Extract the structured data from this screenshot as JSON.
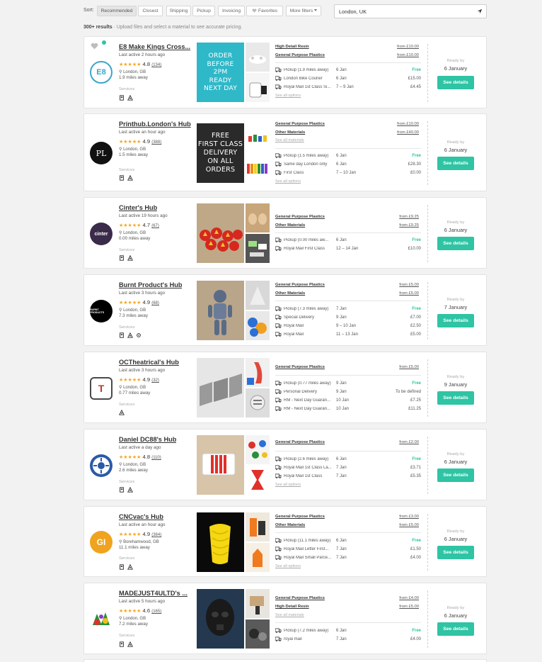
{
  "sort": {
    "label": "Sort:",
    "options": [
      "Recommended",
      "Closest",
      "Shipping",
      "Pickup",
      "Invoicing",
      "Favorites",
      "More filters"
    ],
    "active": "Recommended"
  },
  "location": {
    "value": "London, UK"
  },
  "results": {
    "count": "300+ results",
    "hint": " · Upload files and select a material to see accurate pricing."
  },
  "colors": {
    "accent": "#2ec4a4",
    "star": "#f5a623"
  },
  "hubs": [
    {
      "name": "E8 Make Kings Cross...",
      "active": "Last active 2 hours ago",
      "rating": "4.8",
      "reviews": "(134)",
      "location": "London, GB",
      "distance": "1.9 miles away",
      "services_label": "Services",
      "logo_text": "E8",
      "promo": [
        "ORDER",
        "BEFORE",
        "2PM",
        "READY",
        "NEXT DAY"
      ],
      "materials": [
        {
          "name": "High Detail Resin",
          "price": "from £10.00"
        },
        {
          "name": "General Purpose Plastics",
          "price": "from £10.00"
        }
      ],
      "shipping": [
        {
          "method": "Pickup (1.9 miles away)",
          "date": "6 Jan",
          "price": "Free"
        },
        {
          "method": "London Bike Courier",
          "date": "6 Jan",
          "price": "£15.00"
        },
        {
          "method": "Royal Mail 1st Class Si...",
          "date": "7 – 9 Jan",
          "price": "£4.45"
        }
      ],
      "see_all": "See all options",
      "ready_label": "Ready by",
      "ready_date": "6 January",
      "button": "See details"
    },
    {
      "name": "Printhub.London's Hub",
      "active": "Last active an hour ago",
      "rating": "4.9",
      "reviews": "(388)",
      "location": "London, GB",
      "distance": "1.5 miles away",
      "services_label": "Services",
      "logo_text": "PL",
      "promo": [
        "FREE",
        "FIRST CLASS",
        "DELIVERY",
        "ON ALL",
        "ORDERS"
      ],
      "materials": [
        {
          "name": "General Purpose Plastics",
          "price": "from £10.00"
        },
        {
          "name": "Other Materials",
          "price": "from £40.00"
        }
      ],
      "see_materials": "See all materials",
      "shipping": [
        {
          "method": "Pickup (1.5 miles away)",
          "date": "6 Jan",
          "price": "Free"
        },
        {
          "method": "Same day London only",
          "date": "6 Jan",
          "price": "£28.30"
        },
        {
          "method": "First Class",
          "date": "7 – 10 Jan",
          "price": "£0.00"
        }
      ],
      "see_all": "See all options",
      "ready_label": "Ready by",
      "ready_date": "6 January",
      "button": "See details"
    },
    {
      "name": "Cinter's Hub",
      "active": "Last active 19 hours ago",
      "rating": "4.7",
      "reviews": "(67)",
      "location": "London, GB",
      "distance": "0.00 miles away",
      "services_label": "Services",
      "logo_text": "cinter",
      "materials": [
        {
          "name": "General Purpose Plastics",
          "price": "from £9.25"
        },
        {
          "name": "Other Materials",
          "price": "from £9.25"
        }
      ],
      "shipping": [
        {
          "method": "Pickup (0.00 miles aw...",
          "date": "6 Jan",
          "price": "Free"
        },
        {
          "method": "Royal Mail First Class",
          "date": "12 – 14 Jan",
          "price": "£10.00"
        }
      ],
      "ready_label": "Ready by",
      "ready_date": "6 January",
      "button": "See details"
    },
    {
      "name": "Burnt Product's Hub",
      "active": "Last active 3 hours ago",
      "rating": "4.9",
      "reviews": "(68)",
      "location": "London, GB",
      "distance": "7.3 miles away",
      "services_label": "Services",
      "logo_text": "BURNT PRODUCTS",
      "materials": [
        {
          "name": "General Purpose Plastics",
          "price": "from £5.00"
        },
        {
          "name": "Other Materials",
          "price": "from £5.00"
        }
      ],
      "shipping": [
        {
          "method": "Pickup (7.3 miles away)",
          "date": "7 Jan",
          "price": "Free"
        },
        {
          "method": "Special Delivery",
          "date": "9 Jan",
          "price": "£7.00"
        },
        {
          "method": "Royal Mail",
          "date": "9 – 10 Jan",
          "price": "£2.50"
        },
        {
          "method": "Royal Mail",
          "date": "11 – 13 Jan",
          "price": "£5.00"
        }
      ],
      "ready_label": "Ready by",
      "ready_date": "7 January",
      "button": "See details"
    },
    {
      "name": "OCTheatrical's Hub",
      "active": "Last active 3 hours ago",
      "rating": "4.9",
      "reviews": "(32)",
      "location": "London, GB",
      "distance": "0.77 miles away",
      "services_label": "Services",
      "logo_text": "T",
      "materials": [
        {
          "name": "General Purpose Plastics",
          "price": "from £5.00"
        }
      ],
      "shipping": [
        {
          "method": "Pickup (0.77 miles away)",
          "date": "9 Jan",
          "price": "Free"
        },
        {
          "method": "Personal Delivery",
          "date": "9 Jan",
          "price": "To be defined"
        },
        {
          "method": "RM - Next Day Guaran...",
          "date": "10 Jan",
          "price": "£7.25"
        },
        {
          "method": "RM - Next Day Guaran...",
          "date": "10 Jan",
          "price": "£11.25"
        }
      ],
      "ready_label": "Ready by",
      "ready_date": "9 January",
      "button": "See details"
    },
    {
      "name": "Daniel DC88's Hub",
      "active": "Last active a day ago",
      "rating": "4.8",
      "reviews": "(110)",
      "location": "London, GB",
      "distance": "2.6 miles away",
      "services_label": "Services",
      "logo_text": "",
      "materials": [
        {
          "name": "General Purpose Plastics",
          "price": "from £2.00"
        }
      ],
      "shipping": [
        {
          "method": "Pickup (2.6 miles away)",
          "date": "6 Jan",
          "price": "Free"
        },
        {
          "method": "Royal Mail 1st Class La...",
          "date": "7 Jan",
          "price": "£3.71"
        },
        {
          "method": "Royal Mail 1st Class",
          "date": "7 Jan",
          "price": "£5.35"
        }
      ],
      "see_all": "See all options",
      "ready_label": "Ready by",
      "ready_date": "6 January",
      "button": "See details"
    },
    {
      "name": "CNCvac's Hub",
      "active": "Last active an hour ago",
      "rating": "4.9",
      "reviews": "(384)",
      "location": "Borehamwood, GB",
      "distance": "11.1 miles away",
      "services_label": "Services",
      "logo_text": "GI",
      "materials": [
        {
          "name": "General Purpose Plastics",
          "price": "from £3.00"
        },
        {
          "name": "Other Materials",
          "price": "from £5.00"
        }
      ],
      "shipping": [
        {
          "method": "Pickup (11.1 miles away)",
          "date": "6 Jan",
          "price": "Free"
        },
        {
          "method": "Royal Mail Letter First...",
          "date": "7 Jan",
          "price": "£1.50"
        },
        {
          "method": "Royal Mail Small Parce...",
          "date": "7 Jan",
          "price": "£4.00"
        }
      ],
      "see_all": "See all options",
      "ready_label": "Ready by",
      "ready_date": "6 January",
      "button": "See details"
    },
    {
      "name": "MADEJUST4ULTD's ...",
      "active": "Last active 5 hours ago",
      "rating": "4.6",
      "reviews": "(165)",
      "location": "London, GB",
      "distance": "7.2 miles away",
      "services_label": "Services",
      "logo_text": "",
      "materials": [
        {
          "name": "General Purpose Plastics",
          "price": "from £4.00"
        },
        {
          "name": "High Detail Resin",
          "price": "from £5.00"
        }
      ],
      "see_materials": "See all materials",
      "shipping": [
        {
          "method": "Pickup (7.2 miles away)",
          "date": "6 Jan",
          "price": "Free"
        },
        {
          "method": "royal mail",
          "date": "7 Jan",
          "price": "£4.00"
        }
      ],
      "ready_label": "Ready by",
      "ready_date": "6 January",
      "button": "See details"
    }
  ]
}
